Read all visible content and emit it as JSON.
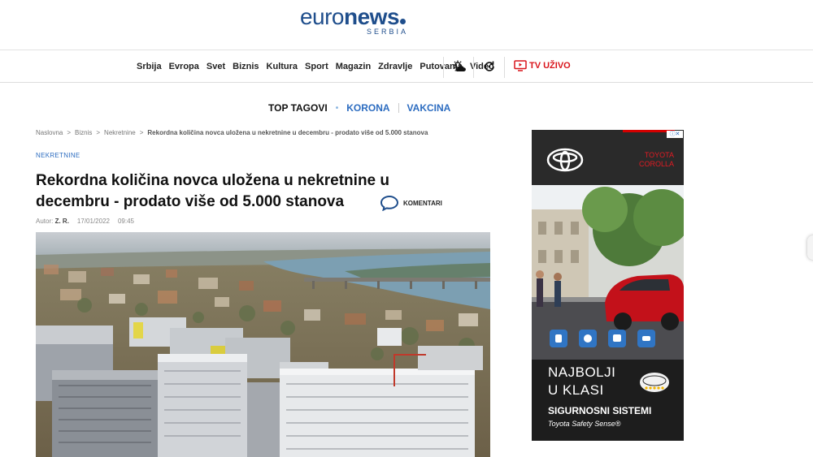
{
  "logo": {
    "main_light": "euro",
    "main_bold": "news",
    "sub": "SERBIA"
  },
  "nav": {
    "items": [
      "Srbija",
      "Evropa",
      "Svet",
      "Biznis",
      "Kultura",
      "Sport",
      "Magazin",
      "Zdravlje",
      "Putovanja",
      "Video"
    ],
    "weather_icon": "weather-icon",
    "refresh_icon": "refresh-icon",
    "live_label": "TV UŽIVO",
    "live_color": "#d9141b"
  },
  "top_tags": {
    "title": "TOP TAGOVI",
    "tags": [
      "KORONA",
      "VAKCINA"
    ],
    "tag_color": "#2c6cc0"
  },
  "breadcrumb": [
    "Naslovna",
    "Biznis",
    "Nekretnine",
    "Rekordna količina novca uložena u nekretnine u decembru - prodato više od 5.000 stanova"
  ],
  "breadcrumb_sep": ">",
  "article": {
    "category": "NEKRETNINE",
    "headline_line1": "Rekordna količina novca uložena u nekretnine u",
    "headline_line2": "decembru - prodato više od 5.000 stanova",
    "comments_label": "KOMENTARI",
    "author_label": "Autor:",
    "author": "Z. R.",
    "date": "17/01/2022",
    "time": "09:45"
  },
  "ad": {
    "brand_line1": "TOYOTA",
    "brand_line2": "COROLLA",
    "close_label": "ⓘ✕",
    "headline_line1": "NAJBOLJI",
    "headline_line2": "U KLASI",
    "feature": "SIGURNOSNI SISTEMI",
    "tss": "Toyota Safety Sense®",
    "brand_color": "#e21b23"
  }
}
